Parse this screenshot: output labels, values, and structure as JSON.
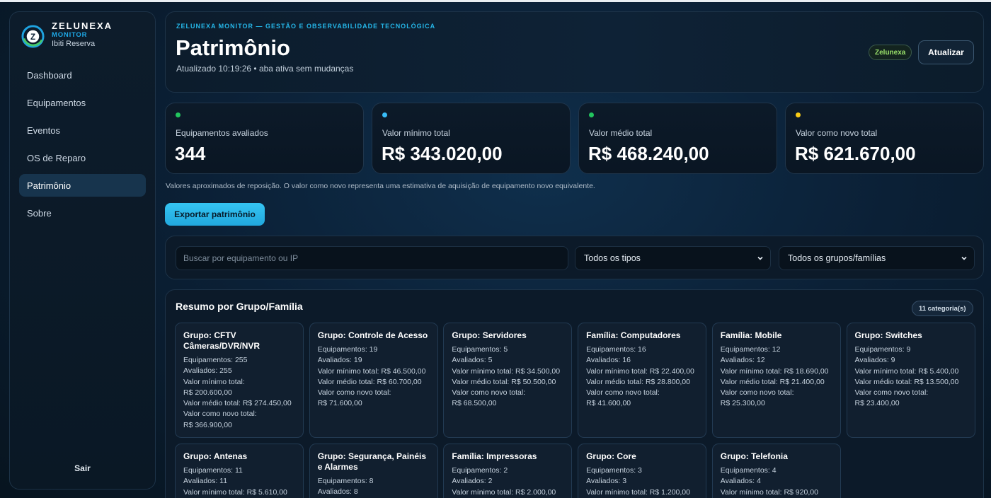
{
  "sidebar": {
    "brand_name": "ZELUNEXA",
    "brand_sub": "MONITOR",
    "site": "Ibiti Reserva",
    "items": [
      {
        "label": "Dashboard"
      },
      {
        "label": "Equipamentos"
      },
      {
        "label": "Eventos"
      },
      {
        "label": "OS de Reparo"
      },
      {
        "label": "Patrimônio",
        "active": true
      },
      {
        "label": "Sobre"
      }
    ],
    "logout": "Sair"
  },
  "header": {
    "eyebrow": "ZELUNEXA MONITOR — GESTÃO E OBSERVABILIDADE TECNOLÓGICA",
    "title": "Patrimônio",
    "updated": "Atualizado 10:19:26 • aba ativa sem mudanças",
    "brand_pill": "Zelunexa",
    "refresh_label": "Atualizar"
  },
  "kpis": [
    {
      "label": "Equipamentos avaliados",
      "value": "344",
      "dot_color": "#22c55e"
    },
    {
      "label": "Valor mínimo total",
      "value": "R$ 343.020,00",
      "dot_color": "#38bdf8"
    },
    {
      "label": "Valor médio total",
      "value": "R$ 468.240,00",
      "dot_color": "#22c55e"
    },
    {
      "label": "Valor como novo total",
      "value": "R$ 621.670,00",
      "dot_color": "#facc15"
    }
  ],
  "note": "Valores aproximados de reposição. O valor como novo representa uma estimativa de aquisição de equipamento novo equivalente.",
  "export_label": "Exportar patrimônio",
  "filters": {
    "search_placeholder": "Buscar por equipamento ou IP",
    "search_value": "",
    "type_selected": "Todos os tipos",
    "group_selected": "Todos os grupos/famílias"
  },
  "summary": {
    "title": "Resumo por Grupo/Família",
    "count": "11 categoria(s)",
    "groups": [
      {
        "title": "Grupo: CFTV Câmeras/DVR/NVR",
        "lines": [
          "Equipamentos: 255",
          "Avaliados: 255",
          "Valor mínimo total:",
          "R$ 200.600,00",
          "Valor médio total: R$ 274.450,00",
          "Valor como novo total:",
          "R$ 366.900,00"
        ]
      },
      {
        "title": "Grupo: Controle de Acesso",
        "lines": [
          "Equipamentos: 19",
          "Avaliados: 19",
          "Valor mínimo total: R$ 46.500,00",
          "Valor médio total: R$ 60.700,00",
          "Valor como novo total:",
          "R$ 71.600,00"
        ]
      },
      {
        "title": "Grupo: Servidores",
        "lines": [
          "Equipamentos: 5",
          "Avaliados: 5",
          "Valor mínimo total: R$ 34.500,00",
          "Valor médio total: R$ 50.500,00",
          "Valor como novo total:",
          "R$ 68.500,00"
        ]
      },
      {
        "title": "Família: Computadores",
        "lines": [
          "Equipamentos: 16",
          "Avaliados: 16",
          "Valor mínimo total: R$ 22.400,00",
          "Valor médio total: R$ 28.800,00",
          "Valor como novo total:",
          "R$ 41.600,00"
        ]
      },
      {
        "title": "Família: Mobile",
        "lines": [
          "Equipamentos: 12",
          "Avaliados: 12",
          "Valor mínimo total: R$ 18.690,00",
          "Valor médio total: R$ 21.400,00",
          "Valor como novo total:",
          "R$ 25.300,00"
        ]
      },
      {
        "title": "Grupo: Switches",
        "lines": [
          "Equipamentos: 9",
          "Avaliados: 9",
          "Valor mínimo total: R$ 5.400,00",
          "Valor médio total: R$ 13.500,00",
          "Valor como novo total:",
          "R$ 23.400,00"
        ]
      },
      {
        "title": "Grupo: Antenas",
        "lines": [
          "Equipamentos: 11",
          "Avaliados: 11",
          "Valor mínimo total: R$ 5.610,00"
        ]
      },
      {
        "title": "Grupo: Segurança, Painéis e Alarmes",
        "lines": [
          "Equipamentos: 8",
          "Avaliados: 8"
        ]
      },
      {
        "title": "Família: Impressoras",
        "lines": [
          "Equipamentos: 2",
          "Avaliados: 2",
          "Valor mínimo total: R$ 2.000,00"
        ]
      },
      {
        "title": "Grupo: Core",
        "lines": [
          "Equipamentos: 3",
          "Avaliados: 3",
          "Valor mínimo total: R$ 1.200,00"
        ]
      },
      {
        "title": "Grupo: Telefonia",
        "lines": [
          "Equipamentos: 4",
          "Avaliados: 4",
          "Valor mínimo total: R$ 920,00"
        ]
      }
    ]
  }
}
